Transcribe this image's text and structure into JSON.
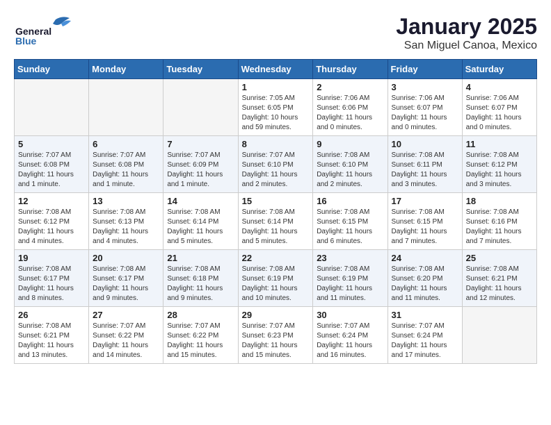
{
  "logo": {
    "general": "General",
    "blue": "Blue"
  },
  "title": "January 2025",
  "subtitle": "San Miguel Canoa, Mexico",
  "weekdays": [
    "Sunday",
    "Monday",
    "Tuesday",
    "Wednesday",
    "Thursday",
    "Friday",
    "Saturday"
  ],
  "weeks": [
    [
      {
        "day": "",
        "info": ""
      },
      {
        "day": "",
        "info": ""
      },
      {
        "day": "",
        "info": ""
      },
      {
        "day": "1",
        "info": "Sunrise: 7:05 AM\nSunset: 6:05 PM\nDaylight: 10 hours\nand 59 minutes."
      },
      {
        "day": "2",
        "info": "Sunrise: 7:06 AM\nSunset: 6:06 PM\nDaylight: 11 hours\nand 0 minutes."
      },
      {
        "day": "3",
        "info": "Sunrise: 7:06 AM\nSunset: 6:07 PM\nDaylight: 11 hours\nand 0 minutes."
      },
      {
        "day": "4",
        "info": "Sunrise: 7:06 AM\nSunset: 6:07 PM\nDaylight: 11 hours\nand 0 minutes."
      }
    ],
    [
      {
        "day": "5",
        "info": "Sunrise: 7:07 AM\nSunset: 6:08 PM\nDaylight: 11 hours\nand 1 minute."
      },
      {
        "day": "6",
        "info": "Sunrise: 7:07 AM\nSunset: 6:08 PM\nDaylight: 11 hours\nand 1 minute."
      },
      {
        "day": "7",
        "info": "Sunrise: 7:07 AM\nSunset: 6:09 PM\nDaylight: 11 hours\nand 1 minute."
      },
      {
        "day": "8",
        "info": "Sunrise: 7:07 AM\nSunset: 6:10 PM\nDaylight: 11 hours\nand 2 minutes."
      },
      {
        "day": "9",
        "info": "Sunrise: 7:08 AM\nSunset: 6:10 PM\nDaylight: 11 hours\nand 2 minutes."
      },
      {
        "day": "10",
        "info": "Sunrise: 7:08 AM\nSunset: 6:11 PM\nDaylight: 11 hours\nand 3 minutes."
      },
      {
        "day": "11",
        "info": "Sunrise: 7:08 AM\nSunset: 6:12 PM\nDaylight: 11 hours\nand 3 minutes."
      }
    ],
    [
      {
        "day": "12",
        "info": "Sunrise: 7:08 AM\nSunset: 6:12 PM\nDaylight: 11 hours\nand 4 minutes."
      },
      {
        "day": "13",
        "info": "Sunrise: 7:08 AM\nSunset: 6:13 PM\nDaylight: 11 hours\nand 4 minutes."
      },
      {
        "day": "14",
        "info": "Sunrise: 7:08 AM\nSunset: 6:14 PM\nDaylight: 11 hours\nand 5 minutes."
      },
      {
        "day": "15",
        "info": "Sunrise: 7:08 AM\nSunset: 6:14 PM\nDaylight: 11 hours\nand 5 minutes."
      },
      {
        "day": "16",
        "info": "Sunrise: 7:08 AM\nSunset: 6:15 PM\nDaylight: 11 hours\nand 6 minutes."
      },
      {
        "day": "17",
        "info": "Sunrise: 7:08 AM\nSunset: 6:15 PM\nDaylight: 11 hours\nand 7 minutes."
      },
      {
        "day": "18",
        "info": "Sunrise: 7:08 AM\nSunset: 6:16 PM\nDaylight: 11 hours\nand 7 minutes."
      }
    ],
    [
      {
        "day": "19",
        "info": "Sunrise: 7:08 AM\nSunset: 6:17 PM\nDaylight: 11 hours\nand 8 minutes."
      },
      {
        "day": "20",
        "info": "Sunrise: 7:08 AM\nSunset: 6:17 PM\nDaylight: 11 hours\nand 9 minutes."
      },
      {
        "day": "21",
        "info": "Sunrise: 7:08 AM\nSunset: 6:18 PM\nDaylight: 11 hours\nand 9 minutes."
      },
      {
        "day": "22",
        "info": "Sunrise: 7:08 AM\nSunset: 6:19 PM\nDaylight: 11 hours\nand 10 minutes."
      },
      {
        "day": "23",
        "info": "Sunrise: 7:08 AM\nSunset: 6:19 PM\nDaylight: 11 hours\nand 11 minutes."
      },
      {
        "day": "24",
        "info": "Sunrise: 7:08 AM\nSunset: 6:20 PM\nDaylight: 11 hours\nand 11 minutes."
      },
      {
        "day": "25",
        "info": "Sunrise: 7:08 AM\nSunset: 6:21 PM\nDaylight: 11 hours\nand 12 minutes."
      }
    ],
    [
      {
        "day": "26",
        "info": "Sunrise: 7:08 AM\nSunset: 6:21 PM\nDaylight: 11 hours\nand 13 minutes."
      },
      {
        "day": "27",
        "info": "Sunrise: 7:07 AM\nSunset: 6:22 PM\nDaylight: 11 hours\nand 14 minutes."
      },
      {
        "day": "28",
        "info": "Sunrise: 7:07 AM\nSunset: 6:22 PM\nDaylight: 11 hours\nand 15 minutes."
      },
      {
        "day": "29",
        "info": "Sunrise: 7:07 AM\nSunset: 6:23 PM\nDaylight: 11 hours\nand 15 minutes."
      },
      {
        "day": "30",
        "info": "Sunrise: 7:07 AM\nSunset: 6:24 PM\nDaylight: 11 hours\nand 16 minutes."
      },
      {
        "day": "31",
        "info": "Sunrise: 7:07 AM\nSunset: 6:24 PM\nDaylight: 11 hours\nand 17 minutes."
      },
      {
        "day": "",
        "info": ""
      }
    ]
  ]
}
